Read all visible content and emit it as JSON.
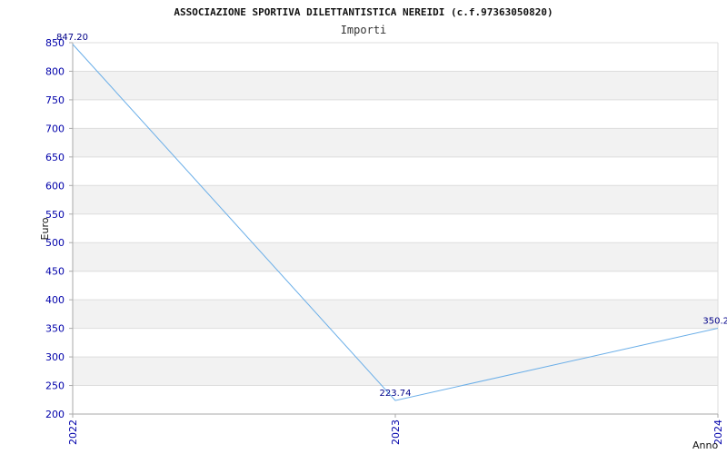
{
  "chart_data": {
    "type": "line",
    "title": "ASSOCIAZIONE SPORTIVA DILETTANTISTICA NEREIDI (c.f.97363050820)",
    "subtitle": "Importi",
    "xlabel": "Anno",
    "ylabel": "Euro",
    "x": [
      "2022",
      "2023",
      "2024"
    ],
    "series": [
      {
        "values": [
          847.2,
          223.74,
          350.2
        ]
      }
    ],
    "data_labels": [
      "847.20",
      "223.74",
      "350.2"
    ],
    "ylim": [
      200,
      850
    ],
    "yticks": [
      200,
      250,
      300,
      350,
      400,
      450,
      500,
      550,
      600,
      650,
      700,
      750,
      800,
      850
    ],
    "grid": true,
    "legend": "none",
    "colors": {
      "line": "#6aaee8",
      "tick_text": "#0000aa",
      "band": "#f2f2f2",
      "grid": "#dddddd",
      "axis": "#aaaaaa",
      "data_label": "#000088"
    }
  }
}
